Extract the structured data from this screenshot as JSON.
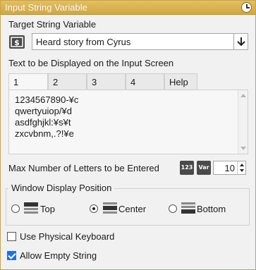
{
  "window": {
    "title": "Input String Variable"
  },
  "target": {
    "label": "Target String Variable",
    "selected": "Heard story from Cyrus"
  },
  "text_section": {
    "label": "Text to be Displayed on the Input Screen",
    "tabs": [
      {
        "label": "1",
        "active": true
      },
      {
        "label": "2",
        "active": false
      },
      {
        "label": "3",
        "active": false
      },
      {
        "label": "4",
        "active": false
      },
      {
        "label": "Help",
        "active": false
      }
    ],
    "lines": [
      "1234567890-¥c",
      "qwertyuiop/¥d",
      "asdfghjkl:¥s¥t",
      "zxcvbnm,.?!¥e"
    ]
  },
  "max_letters": {
    "label": "Max Number of Letters to be Entered",
    "number_icon_text": "123",
    "var_icon_text": "Var",
    "value": "10"
  },
  "display_position": {
    "title": "Window Display Position",
    "options": [
      {
        "label": "Top",
        "selected": false
      },
      {
        "label": "Center",
        "selected": true
      },
      {
        "label": "Bottom",
        "selected": false
      }
    ]
  },
  "options": {
    "physical_keyboard": {
      "label": "Use Physical Keyboard",
      "checked": false
    },
    "allow_empty": {
      "label": "Allow Empty String",
      "checked": true
    }
  },
  "colors": {
    "title_bar": "#d9b04f",
    "panel_bg": "#f1f1f1",
    "check_accent": "#1a73e8"
  },
  "icons": [
    "clock-icon",
    "string-variable-icon",
    "dropdown-arrow-icon",
    "number-input-icon",
    "variable-icon",
    "window-top-icon",
    "window-center-icon",
    "window-bottom-icon"
  ]
}
